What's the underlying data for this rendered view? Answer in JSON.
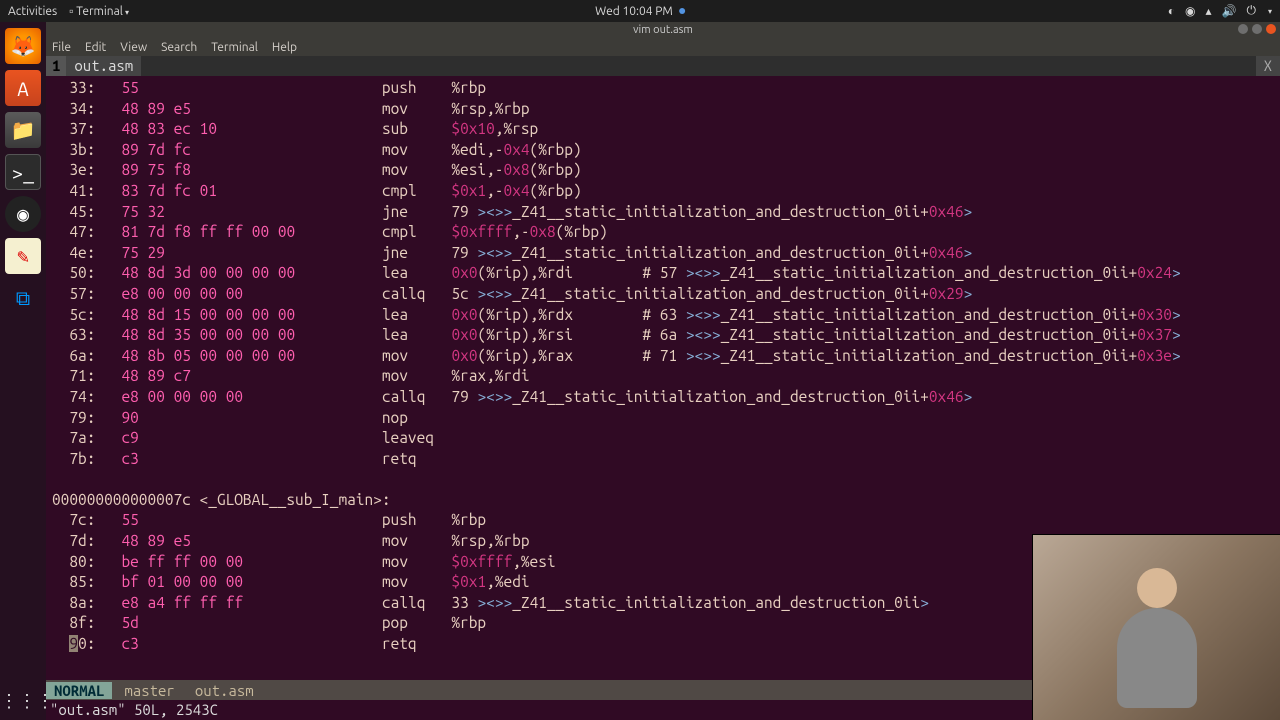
{
  "topbar": {
    "activities": "Activities",
    "app": "Terminal",
    "clock": "Wed 10:04 PM"
  },
  "window": {
    "title": "vim out.asm"
  },
  "menubar": [
    "File",
    "Edit",
    "View",
    "Search",
    "Terminal",
    "Help"
  ],
  "tab": {
    "num": "1",
    "name": "out.asm",
    "close": "X"
  },
  "asm": [
    {
      "addr": "33",
      "bytes": "55",
      "op": "push",
      "args": "%rbp"
    },
    {
      "addr": "34",
      "bytes": "48 89 e5",
      "op": "mov",
      "args": "%rsp,%rbp"
    },
    {
      "addr": "37",
      "bytes": "48 83 ec 10",
      "op": "sub",
      "args": "$0x10,%rsp"
    },
    {
      "addr": "3b",
      "bytes": "89 7d fc",
      "op": "mov",
      "args": "%edi,-0x4(%rbp)"
    },
    {
      "addr": "3e",
      "bytes": "89 75 f8",
      "op": "mov",
      "args": "%esi,-0x8(%rbp)"
    },
    {
      "addr": "41",
      "bytes": "83 7d fc 01",
      "op": "cmpl",
      "args": "$0x1,-0x4(%rbp)"
    },
    {
      "addr": "45",
      "bytes": "75 32",
      "op": "jne",
      "args": "79 <_Z41__static_initialization_and_destruction_0ii+0x46>"
    },
    {
      "addr": "47",
      "bytes": "81 7d f8 ff ff 00 00",
      "op": "cmpl",
      "args": "$0xffff,-0x8(%rbp)"
    },
    {
      "addr": "4e",
      "bytes": "75 29",
      "op": "jne",
      "args": "79 <_Z41__static_initialization_and_destruction_0ii+0x46>"
    },
    {
      "addr": "50",
      "bytes": "48 8d 3d 00 00 00 00",
      "op": "lea",
      "args": "0x0(%rip),%rdi        # 57 <_Z41__static_initialization_and_destruction_0ii+0x24>"
    },
    {
      "addr": "57",
      "bytes": "e8 00 00 00 00",
      "op": "callq",
      "args": "5c <_Z41__static_initialization_and_destruction_0ii+0x29>"
    },
    {
      "addr": "5c",
      "bytes": "48 8d 15 00 00 00 00",
      "op": "lea",
      "args": "0x0(%rip),%rdx        # 63 <_Z41__static_initialization_and_destruction_0ii+0x30>"
    },
    {
      "addr": "63",
      "bytes": "48 8d 35 00 00 00 00",
      "op": "lea",
      "args": "0x0(%rip),%rsi        # 6a <_Z41__static_initialization_and_destruction_0ii+0x37>"
    },
    {
      "addr": "6a",
      "bytes": "48 8b 05 00 00 00 00",
      "op": "mov",
      "args": "0x0(%rip),%rax        # 71 <_Z41__static_initialization_and_destruction_0ii+0x3e>"
    },
    {
      "addr": "71",
      "bytes": "48 89 c7",
      "op": "mov",
      "args": "%rax,%rdi"
    },
    {
      "addr": "74",
      "bytes": "e8 00 00 00 00",
      "op": "callq",
      "args": "79 <_Z41__static_initialization_and_destruction_0ii+0x46>"
    },
    {
      "addr": "79",
      "bytes": "90",
      "op": "nop",
      "args": ""
    },
    {
      "addr": "7a",
      "bytes": "c9",
      "op": "leaveq",
      "args": ""
    },
    {
      "addr": "7b",
      "bytes": "c3",
      "op": "retq",
      "args": ""
    }
  ],
  "section_label": "000000000000007c <_GLOBAL__sub_I_main>:",
  "asm2": [
    {
      "addr": "7c",
      "bytes": "55",
      "op": "push",
      "args": "%rbp"
    },
    {
      "addr": "7d",
      "bytes": "48 89 e5",
      "op": "mov",
      "args": "%rsp,%rbp"
    },
    {
      "addr": "80",
      "bytes": "be ff ff 00 00",
      "op": "mov",
      "args": "$0xffff,%esi"
    },
    {
      "addr": "85",
      "bytes": "bf 01 00 00 00",
      "op": "mov",
      "args": "$0x1,%edi"
    },
    {
      "addr": "8a",
      "bytes": "e8 a4 ff ff ff",
      "op": "callq",
      "args": "33 <_Z41__static_initialization_and_destruction_0ii>"
    },
    {
      "addr": "8f",
      "bytes": "5d",
      "op": "pop",
      "args": "%rbp"
    },
    {
      "addr": "90",
      "bytes": "c3",
      "op": "retq",
      "args": "",
      "cursor": true
    }
  ],
  "statusline": {
    "mode": "NORMAL",
    "branch": "master",
    "filename": "out.asm"
  },
  "cmdline": "\"out.asm\" 50L, 2543C"
}
